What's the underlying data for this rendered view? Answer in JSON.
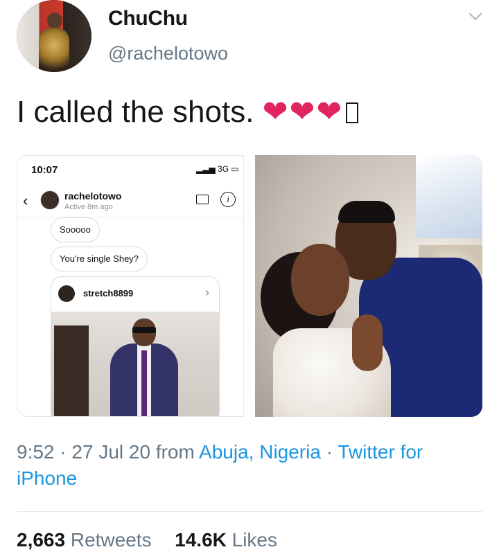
{
  "user": {
    "display_name": "ChuChu",
    "handle": "@rachelotowo"
  },
  "tweet": {
    "text": "I called the shots.",
    "hearts": "❤❤❤"
  },
  "embedded_screenshot": {
    "time": "10:07",
    "signal": "3G",
    "username": "rachelotowo",
    "active_status": "Active 8m ago",
    "messages": [
      "Sooooo",
      "You're single Shey?"
    ],
    "shared_post_user": "stretch8899"
  },
  "meta": {
    "time": "9:52",
    "date": "27 Jul 20",
    "from_label": "from",
    "location": "Abuja, Nigeria",
    "client_line1": "Twitter for",
    "client_line2": "iPhone"
  },
  "stats": {
    "retweets_count": "2,663",
    "retweets_label": "Retweets",
    "likes_count": "14.6K",
    "likes_label": "Likes"
  },
  "colors": {
    "link": "#1b95e0",
    "heart": "#e0245e",
    "secondary_text": "#657786"
  },
  "icons": [
    "chevron-down-icon",
    "back-icon",
    "video-call-icon",
    "info-icon",
    "chevron-right-icon"
  ]
}
